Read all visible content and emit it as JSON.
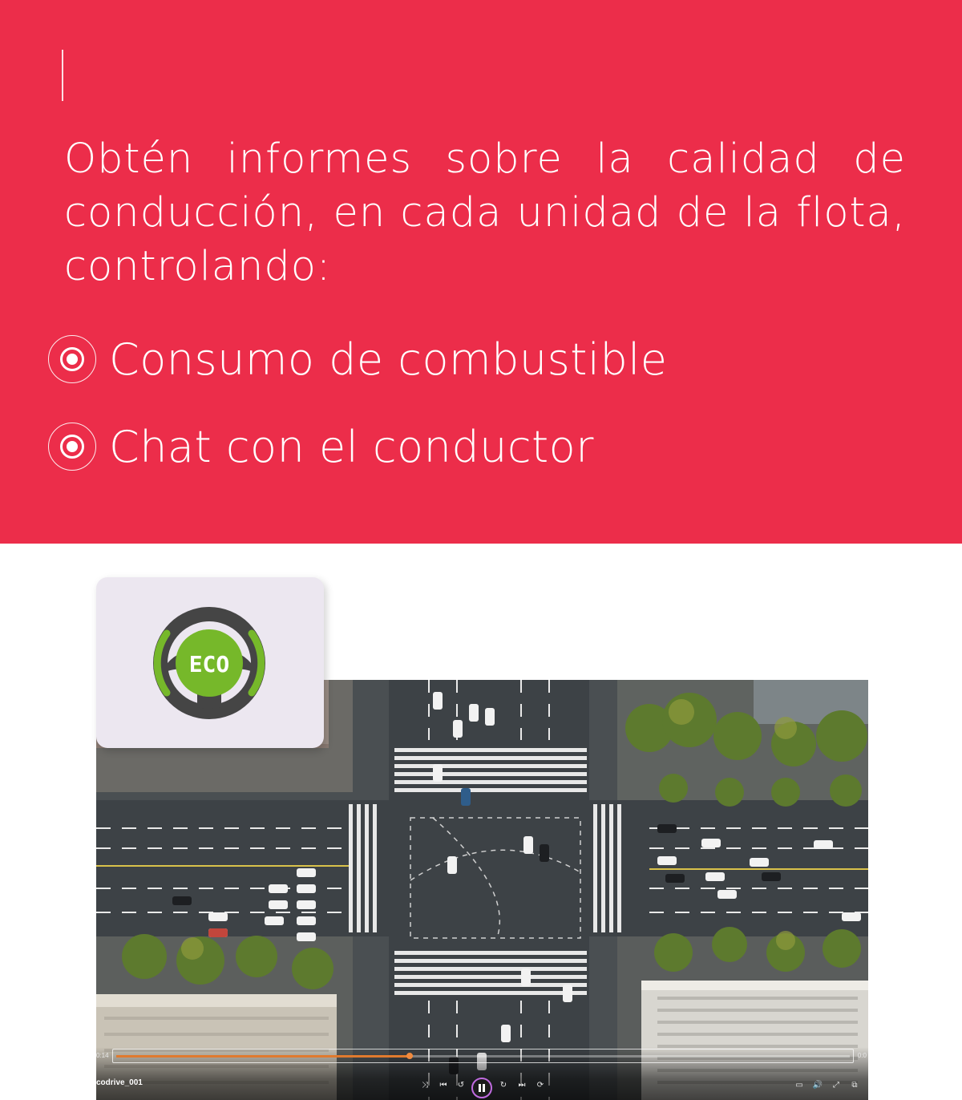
{
  "hero": {
    "intro": "Obtén informes sobre la calidad de conducción, en cada unidad de la flota, controlando:",
    "features": [
      {
        "label": "Consumo de combustible",
        "icon": "target-bullet-icon"
      },
      {
        "label": "Chat con el conductor",
        "icon": "target-bullet-icon"
      }
    ]
  },
  "eco_card": {
    "badge_text": "ECO",
    "icon": "eco-steering-wheel-icon"
  },
  "video": {
    "file_name": "codrive_001",
    "current_time": "0:14",
    "duration": "0:0",
    "progress": 0.4
  },
  "colors": {
    "brand_red": "#ec2d4a",
    "eco_green": "#76b82a",
    "card_bg": "#ece7f0",
    "progress_orange": "#e07a2e"
  }
}
